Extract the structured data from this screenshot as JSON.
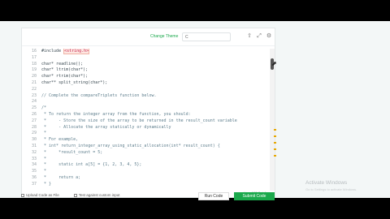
{
  "toolbar": {
    "change_theme": "Change Theme",
    "theme_value": "C",
    "icons": [
      "upload-icon",
      "fullscreen-icon",
      "settings-icon"
    ]
  },
  "code": {
    "lines": [
      {
        "n": "16",
        "text": "#include ",
        "hl": "<string.h>",
        "comment": false
      },
      {
        "n": "17",
        "text": "",
        "comment": false
      },
      {
        "n": "18",
        "text": "char* readline();",
        "comment": false
      },
      {
        "n": "19",
        "text": "char* ltrim(char*);",
        "comment": false
      },
      {
        "n": "20",
        "text": "char* rtrim(char*);",
        "comment": false
      },
      {
        "n": "21",
        "text": "char** split_string(char*);",
        "comment": false
      },
      {
        "n": "22",
        "text": "",
        "comment": false
      },
      {
        "n": "23",
        "text": "// Complete the compareTriplets function below.",
        "comment": true
      },
      {
        "n": "24",
        "text": "",
        "comment": false
      },
      {
        "n": "25",
        "text": "/*",
        "comment": true
      },
      {
        "n": "26",
        "text": " * To return the integer array from the function, you should:",
        "comment": true
      },
      {
        "n": "27",
        "text": " *     - Store the size of the array to be returned in the result_count variable",
        "comment": true
      },
      {
        "n": "28",
        "text": " *     - Allocate the array statically or dynamically",
        "comment": true
      },
      {
        "n": "29",
        "text": " *",
        "comment": true
      },
      {
        "n": "30",
        "text": " * For example,",
        "comment": true
      },
      {
        "n": "31",
        "text": " * int* return_integer_array_using_static_allocation(int* result_count) {",
        "comment": true
      },
      {
        "n": "32",
        "text": " *     *result_count = 5;",
        "comment": true
      },
      {
        "n": "33",
        "text": " *",
        "comment": true
      },
      {
        "n": "34",
        "text": " *     static int a[5] = {1, 2, 3, 4, 5};",
        "comment": true
      },
      {
        "n": "35",
        "text": " *",
        "comment": true
      },
      {
        "n": "36",
        "text": " *     return a;",
        "comment": true
      },
      {
        "n": "37",
        "text": " * }",
        "comment": true
      }
    ],
    "status": "Line: 102 Col: 1"
  },
  "watermark": {
    "title": "Activate Windows",
    "subtitle": "Go to Settings to activate Windows."
  },
  "footer": {
    "upload_label": "Upload Code as File",
    "custom_input_label": "Test against custom input",
    "run_label": "Run Code",
    "submit_label": "Submit Code"
  }
}
